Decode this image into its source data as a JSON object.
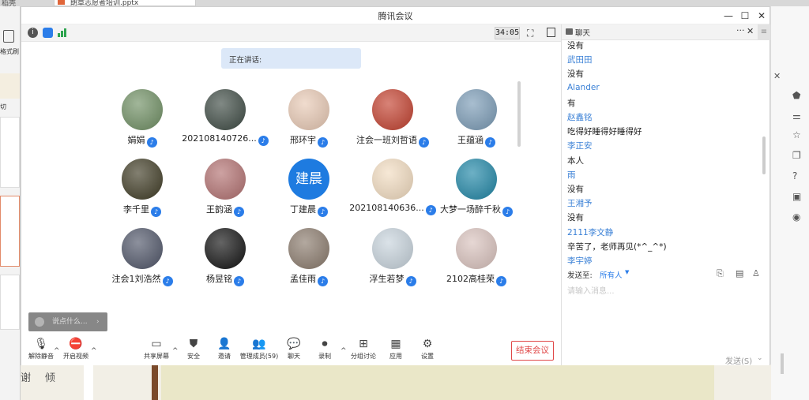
{
  "host_app": {
    "tab_title": "朗章志愿者培训.pptx",
    "left_menu": [
      "格式刷",
      "切"
    ],
    "left_corner": "稻壳",
    "bottom_text": [
      "谢",
      "倾"
    ]
  },
  "window": {
    "title": "腾讯会议",
    "controls": {
      "minimize": "—",
      "maximize": "☐",
      "close": "✕"
    }
  },
  "status": {
    "timer": "34:05"
  },
  "stage": {
    "speaking_label": "正在讲话:",
    "participants": [
      {
        "name": "娟娟",
        "avatar_color": "#6f8f63",
        "avatar_text": ""
      },
      {
        "name": "202108140726...",
        "avatar_color": "#3d4a43",
        "avatar_text": ""
      },
      {
        "name": "邢环宇",
        "avatar_color": "#e8c9b4",
        "avatar_text": ""
      },
      {
        "name": "注会一班刘哲语",
        "avatar_color": "#c3402e",
        "avatar_text": ""
      },
      {
        "name": "王蕴涵",
        "avatar_color": "#7a9bb6",
        "avatar_text": ""
      },
      {
        "name": "李千里",
        "avatar_color": "#3f3b24",
        "avatar_text": ""
      },
      {
        "name": "王韵涵",
        "avatar_color": "#b27070",
        "avatar_text": ""
      },
      {
        "name": "丁建晨",
        "avatar_color": "#1e7be0",
        "avatar_text": "建晨"
      },
      {
        "name": "202108140636...",
        "avatar_color": "#f2dcc0",
        "avatar_text": ""
      },
      {
        "name": "大梦一场醉千秋",
        "avatar_color": "#1f86a6",
        "avatar_text": ""
      },
      {
        "name": "注会1刘浩然",
        "avatar_color": "#4f5568",
        "avatar_text": ""
      },
      {
        "name": "杨昱铭",
        "avatar_color": "#111111",
        "avatar_text": ""
      },
      {
        "name": "孟佳雨",
        "avatar_color": "#8a7a6c",
        "avatar_text": ""
      },
      {
        "name": "浮生若梦",
        "avatar_color": "#c7d3dc",
        "avatar_text": ""
      },
      {
        "name": "2102高桂荣",
        "avatar_color": "#d9c2bd",
        "avatar_text": ""
      }
    ],
    "chat_bubble_placeholder": "说点什么..."
  },
  "toolbar": {
    "unmute": "解除静音",
    "start_video": "开启视频",
    "share_screen": "共享屏幕",
    "security": "安全",
    "invite": "邀请",
    "manage_members": "管理成员(59)",
    "chat": "聊天",
    "record": "录制",
    "breakout": "分组讨论",
    "apps": "应用",
    "settings": "设置",
    "end_meeting": "结束会议"
  },
  "chat": {
    "title": "聊天",
    "messages": [
      {
        "kind": "text",
        "value": "没有"
      },
      {
        "kind": "sender",
        "value": "武田田"
      },
      {
        "kind": "text",
        "value": "没有"
      },
      {
        "kind": "sender",
        "value": "Alander"
      },
      {
        "kind": "text",
        "value": "有"
      },
      {
        "kind": "sender",
        "value": "赵鑫铭"
      },
      {
        "kind": "text",
        "value": "吃得好睡得好睡得好"
      },
      {
        "kind": "sender",
        "value": "李正安"
      },
      {
        "kind": "text",
        "value": "本人"
      },
      {
        "kind": "sender",
        "value": "雨"
      },
      {
        "kind": "text",
        "value": "没有"
      },
      {
        "kind": "sender",
        "value": "王湘予"
      },
      {
        "kind": "text",
        "value": "没有"
      },
      {
        "kind": "sender",
        "value": "2111李文静"
      },
      {
        "kind": "text",
        "value": "辛苦了，老师再见(*^_^*)"
      },
      {
        "kind": "sender",
        "value": "李宇婷"
      }
    ],
    "send_to_label": "发送至:",
    "send_to_value": "所有人",
    "input_placeholder": "请输入消息...",
    "send_button": "发送(S)"
  },
  "colors": {
    "accent": "#2b7de9",
    "sender": "#3a80d6",
    "end_meeting": "#e04848"
  }
}
